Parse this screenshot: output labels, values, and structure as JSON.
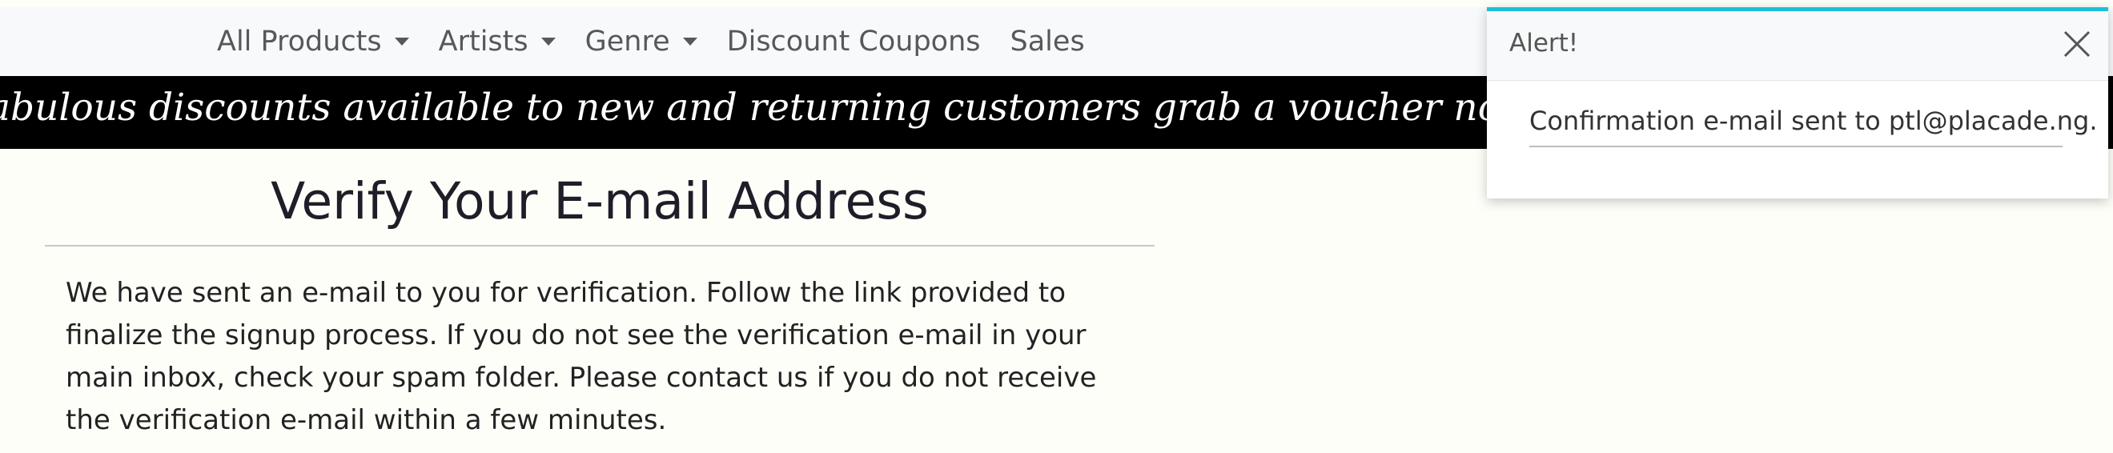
{
  "nav": {
    "items": [
      {
        "label": "All Products",
        "dropdown": true
      },
      {
        "label": "Artists",
        "dropdown": true
      },
      {
        "label": "Genre",
        "dropdown": true
      },
      {
        "label": "Discount Coupons",
        "dropdown": false
      },
      {
        "label": "Sales",
        "dropdown": false
      }
    ]
  },
  "banner": {
    "text": "abulous discounts available to new and returning customers grab a voucher now!"
  },
  "main": {
    "title": "Verify Your E-mail Address",
    "body": "We have sent an e-mail to you for verification. Follow the link provided to finalize the signup process. If you do not see the verification e-mail in your main inbox, check your spam folder. Please contact us if you do not receive the verification e-mail within a few minutes."
  },
  "alert": {
    "title": "Alert!",
    "message": "Confirmation e-mail sent to ptl@placade.ng.",
    "close_icon": "close-icon",
    "accent_color": "#1cc0d8"
  },
  "colors": {
    "nav_bg": "#f8f9fa",
    "banner_bg": "#000000",
    "page_bg": "#fefef9"
  }
}
